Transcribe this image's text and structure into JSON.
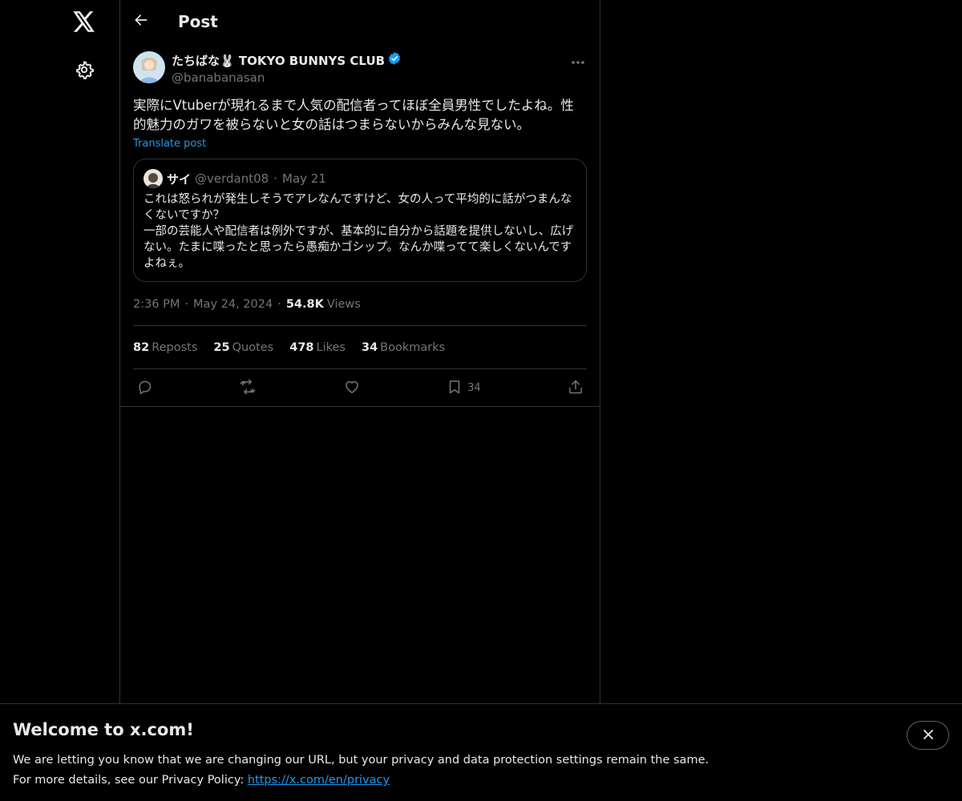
{
  "nav": {
    "logo_icon": "x-logo-icon",
    "settings_icon": "gear-icon"
  },
  "header": {
    "back_icon": "arrow-left-icon",
    "title": "Post"
  },
  "post": {
    "author_name": "たちばな🐰 TOKYO BUNNYS CLUB",
    "verified_icon": "verified-badge-icon",
    "author_handle": "@banabanasan",
    "more_icon": "more-horizontal-icon",
    "text": "実際にVtuberが現れるまで人気の配信者ってほぼ全員男性でしたよね。性的魅力のガワを被らないと女の話はつまらないからみんな見ない。",
    "translate_label": "Translate post",
    "quote": {
      "name": "サイ",
      "handle": "@verdant08",
      "dot": "·",
      "date": "May 21",
      "text": "これは怒られが発生しそうでアレなんですけど、女の人って平均的に話がつまんなくないですか？\n一部の芸能人や配信者は例外ですが、基本的に自分から話題を提供しないし、広げない。たまに喋ったと思ったら愚痴かゴシップ。なんか喋ってて楽しくないんですよねぇ。"
    },
    "time": "2:36 PM",
    "dot": "·",
    "date": "May 24, 2024",
    "views_count": "54.8K",
    "views_label": "Views",
    "stats": {
      "reposts_count": "82",
      "reposts_label": "Reposts",
      "quotes_count": "25",
      "quotes_label": "Quotes",
      "likes_count": "478",
      "likes_label": "Likes",
      "bookmarks_count": "34",
      "bookmarks_label": "Bookmarks"
    },
    "actions": {
      "reply_icon": "reply-icon",
      "repost_icon": "repost-icon",
      "like_icon": "heart-icon",
      "bookmark_icon": "bookmark-icon",
      "bookmark_count": "34",
      "share_icon": "share-icon"
    }
  },
  "banner": {
    "title": "Welcome to x.com!",
    "line1": "We are letting you know that we are changing our URL, but your privacy and data protection settings remain the same.",
    "line2_prefix": "For more details, see our Privacy Policy: ",
    "link": "https://x.com/en/privacy",
    "close_icon": "close-icon"
  },
  "colors": {
    "background": "#000000",
    "text": "#e7e9ea",
    "muted": "#71767b",
    "accent": "#1d9bf0",
    "border": "#2f3336"
  }
}
